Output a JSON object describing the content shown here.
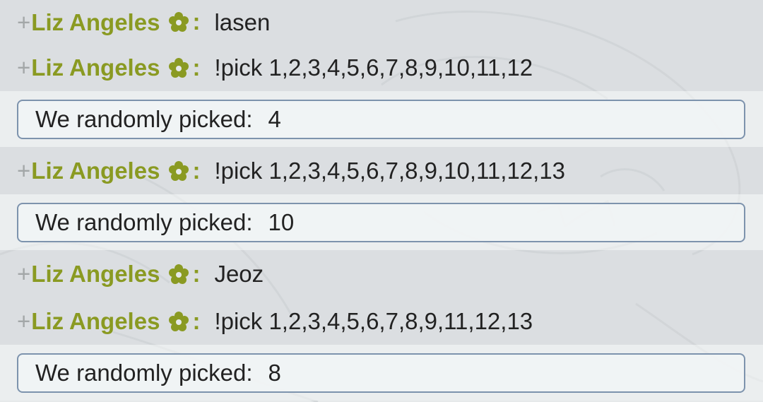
{
  "messages": [
    {
      "type": "user",
      "prefix": "+",
      "user": "Liz Angeles",
      "badge_icon": "flower-icon",
      "colon": ":",
      "text": "lasen"
    },
    {
      "type": "user",
      "prefix": "+",
      "user": "Liz Angeles",
      "badge_icon": "flower-icon",
      "colon": ":",
      "text": "!pick 1,2,3,4,5,6,7,8,9,10,11,12"
    },
    {
      "type": "bot",
      "label": "We randomly picked:",
      "value": "4"
    },
    {
      "type": "user",
      "prefix": "+",
      "user": "Liz Angeles",
      "badge_icon": "flower-icon",
      "colon": ":",
      "text": "!pick 1,2,3,4,5,6,7,8,9,10,11,12,13"
    },
    {
      "type": "bot",
      "label": "We randomly picked:",
      "value": "10"
    },
    {
      "type": "user",
      "prefix": "+",
      "user": "Liz Angeles",
      "badge_icon": "flower-icon",
      "colon": ":",
      "text": "Jeoz"
    },
    {
      "type": "user",
      "prefix": "+",
      "user": "Liz Angeles",
      "badge_icon": "flower-icon",
      "colon": ":",
      "text": "!pick 1,2,3,4,5,6,7,8,9,11,12,13"
    },
    {
      "type": "bot",
      "label": "We randomly picked:",
      "value": "8"
    }
  ],
  "colors": {
    "username": "#8a9a22",
    "prefix": "#a3a7a8",
    "text": "#222222",
    "pick_border": "#7d93ad",
    "background": "#e6e9ea"
  }
}
